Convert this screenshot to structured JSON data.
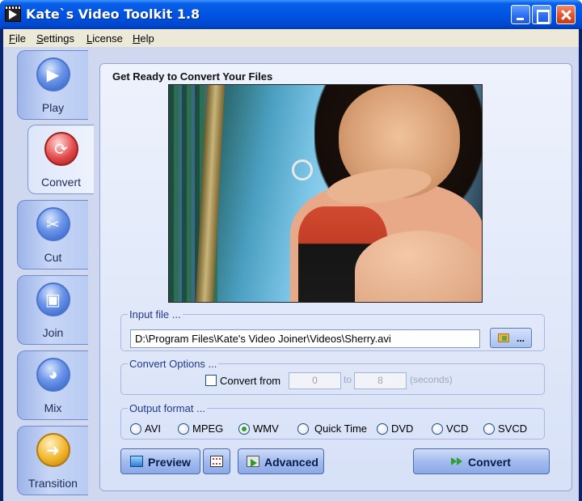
{
  "window": {
    "title": "Kate`s Video Toolkit 1.8"
  },
  "menu": {
    "file": {
      "hotkey": "F",
      "rest": "ile"
    },
    "settings": {
      "hotkey": "S",
      "rest": "ettings"
    },
    "license": {
      "hotkey": "L",
      "rest": "icense"
    },
    "help": {
      "hotkey": "H",
      "rest": "elp"
    }
  },
  "sidebar": {
    "active": "Convert",
    "items": [
      {
        "label": "Play",
        "icon": "play-icon"
      },
      {
        "label": "Convert",
        "icon": "convert-icon"
      },
      {
        "label": "Cut",
        "icon": "scissors-icon"
      },
      {
        "label": "Join",
        "icon": "join-icon"
      },
      {
        "label": "Mix",
        "icon": "mix-icon"
      },
      {
        "label": "Transition",
        "icon": "arrow-right-icon"
      }
    ]
  },
  "panel": {
    "title": "Get Ready to Convert Your Files"
  },
  "input_file": {
    "legend": "Input file ...",
    "value": "D:\\Program Files\\Kate's Video Joiner\\Videos\\Sherry.avi",
    "browse_label": "..."
  },
  "convert_options": {
    "legend": "Convert Options ...",
    "checkbox_label": "Convert from",
    "checked": false,
    "from_value": "0",
    "to_label": "to",
    "to_value": "8",
    "unit_label": "(seconds)"
  },
  "output_format": {
    "legend": "Output format ...",
    "selected": "WMV",
    "options": [
      "AVI",
      "MPEG",
      "WMV",
      "Quick Time",
      "DVD",
      "VCD",
      "SVCD"
    ]
  },
  "buttons": {
    "preview": "Preview",
    "advanced": "Advanced",
    "convert": "Convert"
  },
  "colors": {
    "titlebar": "#0054e3",
    "panel_bg": "#e4eaf9",
    "selected_radio": "#2fa02f"
  }
}
